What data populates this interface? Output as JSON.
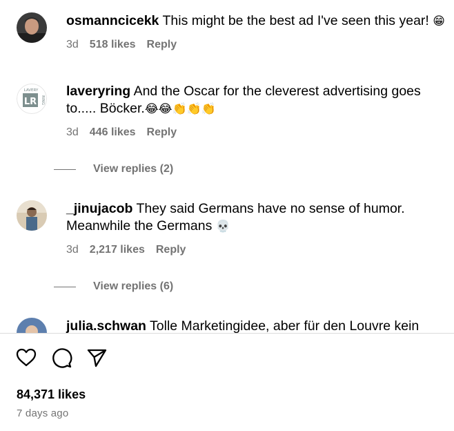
{
  "comments": [
    {
      "username": "osmanncicekk",
      "text": "This might be the best ad I've seen this year!",
      "emoji": "😁",
      "time": "3d",
      "likes": "518 likes",
      "reply": "Reply"
    },
    {
      "username": "laveryring",
      "text_line1": "And the Oscar for the cleverest advertising goes",
      "text_line2": "to..... Böcker.",
      "emoji": "😂😂👏👏👏",
      "avatar_text": "LAVERY",
      "avatar_side": "RING",
      "avatar_mark": "LR",
      "time": "3d",
      "likes": "446 likes",
      "reply": "Reply",
      "view_replies": "View replies (2)"
    },
    {
      "username": "_jinujacob",
      "text_line1": "They said Germans have no sense of humor.",
      "text_line2": "Meanwhile the Germans",
      "emoji": "💀",
      "time": "3d",
      "likes": "2,217 likes",
      "reply": "Reply",
      "view_replies": "View replies (6)"
    },
    {
      "username": "julia.schwan",
      "text": "Tolle Marketingidee, aber für den Louvre kein"
    }
  ],
  "post": {
    "likes": "84,371 likes",
    "time_ago": "7 days ago"
  },
  "icons": [
    "heart-icon",
    "comment-icon",
    "share-icon"
  ],
  "colors": {
    "secondary_text": "#737373",
    "divider": "#dbdbdb"
  }
}
